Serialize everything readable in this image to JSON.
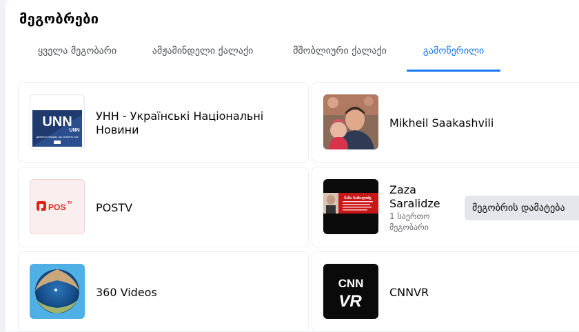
{
  "header": {
    "title": "მეგობრები"
  },
  "tabs": [
    {
      "label": "ყველა მეგობარი"
    },
    {
      "label": "ამჟამინდელი ქალაქი"
    },
    {
      "label": "მშობლიური ქალაქი"
    },
    {
      "label": "გამოწერილი"
    }
  ],
  "active_tab": "გამოწერილი",
  "colors": {
    "accent": "#1877f2",
    "secondary_text": "#65676b",
    "button_bg": "#e4e6eb"
  },
  "cards": [
    {
      "name": "УНН - Українські Національні Новини",
      "logo_text": "UNN",
      "logo_sub": "UNN",
      "logo_tag": "Джерело людям, що роблять нас"
    },
    {
      "name": "Mikheil Saakashvili"
    },
    {
      "name": "POSTV",
      "logo_text": "POS",
      "logo_sup": "TV"
    },
    {
      "name": "Zaza Saralidze",
      "mutual": "1 საერთო მეგობარი",
      "add_button": "მეგობრის დამატება",
      "thumb_text": "ზაზა სარალიძე"
    },
    {
      "name": "360 Videos"
    },
    {
      "name": "CNNVR",
      "logo_top": "CNN",
      "logo_bottom": "VR"
    }
  ]
}
